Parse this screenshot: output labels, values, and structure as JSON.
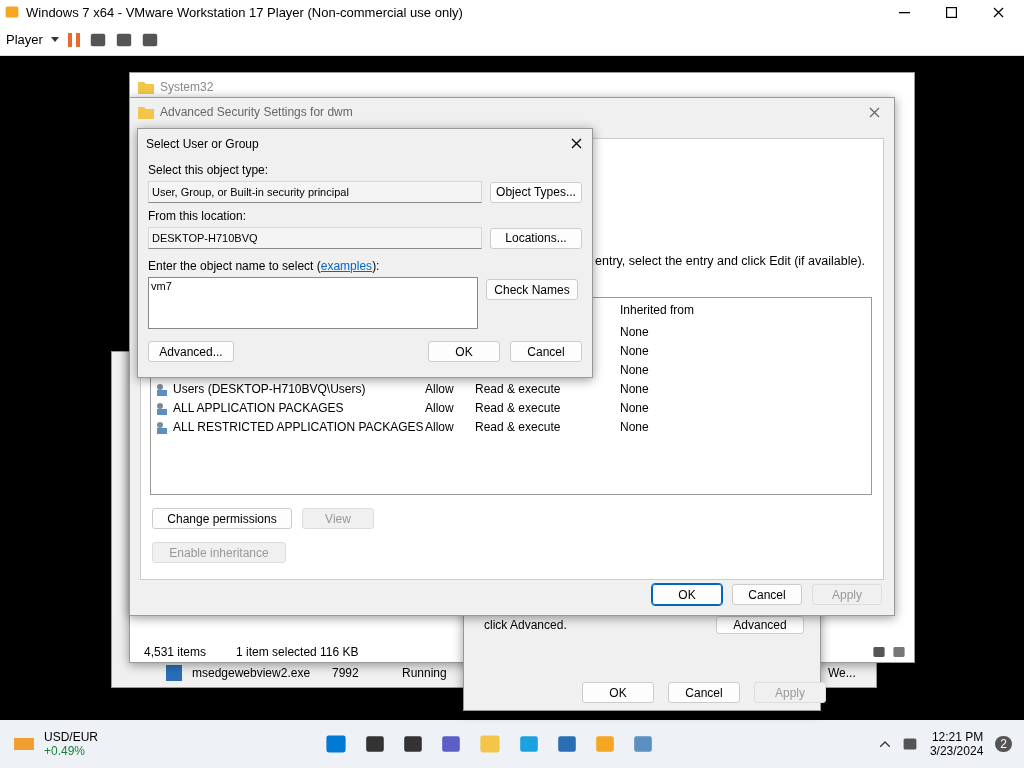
{
  "vm_window": {
    "title": "Windows 7 x64 - VMware Workstation 17 Player (Non-commercial use only)",
    "menu": "Player"
  },
  "explorer": {
    "title": "System32",
    "status": [
      "4,531 items",
      "1 item selected  116 KB"
    ]
  },
  "task_manager": {
    "row": {
      "name": "msedgewebview2.exe",
      "pid": "7992",
      "status": "Running",
      "cut": "We..."
    }
  },
  "properties": {
    "text": "click Advanced.",
    "buttons": [
      {
        "label": "Advanced",
        "disabled": false
      },
      {
        "label": "OK",
        "disabled": false
      },
      {
        "label": "Cancel",
        "disabled": false
      },
      {
        "label": "Apply",
        "disabled": true
      }
    ]
  },
  "advanced_security": {
    "title": "Advanced Security Settings for dwm",
    "hint": "entry, select the entry and click Edit (if available).",
    "columns": [
      "",
      "",
      "",
      "Inherited from"
    ],
    "rows": [
      {
        "principal": "",
        "access": "",
        "applies": "",
        "inherited": "None"
      },
      {
        "principal": "",
        "access": "",
        "applies": "",
        "inherited": "None"
      },
      {
        "principal": "",
        "access": "",
        "applies": "",
        "inherited": "None"
      },
      {
        "principal": "Users (DESKTOP-H710BVQ\\Users)",
        "access": "Allow",
        "applies": "Read & execute",
        "inherited": "None"
      },
      {
        "principal": "ALL APPLICATION PACKAGES",
        "access": "Allow",
        "applies": "Read & execute",
        "inherited": "None"
      },
      {
        "principal": "ALL RESTRICTED APPLICATION PACKAGES",
        "access": "Allow",
        "applies": "Read & execute",
        "inherited": "None"
      }
    ],
    "actions": [
      {
        "label": "Change permissions",
        "disabled": false
      },
      {
        "label": "View",
        "disabled": true
      }
    ],
    "inherit": {
      "label": "Enable inheritance",
      "disabled": true
    },
    "buttons": [
      {
        "label": "OK",
        "disabled": false,
        "selected": true
      },
      {
        "label": "Cancel",
        "disabled": false,
        "selected": false
      },
      {
        "label": "Apply",
        "disabled": true,
        "selected": false
      }
    ]
  },
  "select_dialog": {
    "title": "Select User or Group",
    "type_label": "Select this object type:",
    "type_value": "User, Group, or Built-in security principal",
    "type_button": "Object Types...",
    "location_label": "From this location:",
    "location_value": "DESKTOP-H710BVQ",
    "location_button": "Locations...",
    "name_label": "Enter the object name to select (",
    "name_link": "examples",
    "name_label_end": "):",
    "name_value": "vm7",
    "check_button": "Check Names",
    "advanced_button": "Advanced...",
    "ok_button": "OK",
    "cancel_button": "Cancel"
  },
  "taskbar": {
    "widget_title": "USD/EUR",
    "widget_value": "+0.49%",
    "time": "12:21 PM",
    "date": "3/23/2024",
    "badge": "2"
  }
}
